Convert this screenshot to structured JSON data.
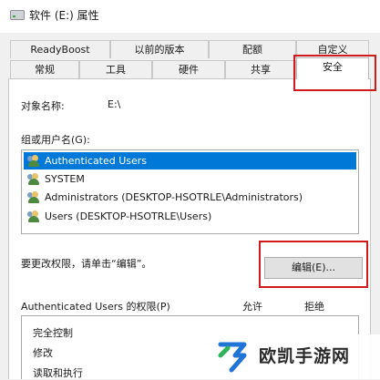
{
  "window": {
    "title": "软件 (E:) 属性"
  },
  "tabs_top": [
    "ReadyBoost",
    "以前的版本",
    "配额",
    "自定义"
  ],
  "tabs_bottom": [
    "常规",
    "工具",
    "硬件",
    "共享",
    "安全"
  ],
  "active_tab": "安全",
  "object": {
    "label": "对象名称:",
    "value": "E:\\"
  },
  "group_label": "组或用户名(G):",
  "users": [
    "Authenticated Users",
    "SYSTEM",
    "Administrators (DESKTOP-HSOTRLE\\Administrators)",
    "Users (DESKTOP-HSOTRLE\\Users)"
  ],
  "selected_user_index": 0,
  "change_hint": "要更改权限，请单击“编辑”。",
  "edit_button": "编辑(E)...",
  "permissions": {
    "header": "Authenticated Users 的权限(P)",
    "allow": "允许",
    "deny": "拒绝",
    "rows": [
      "完全控制",
      "修改",
      "读取和执行"
    ]
  },
  "watermark": {
    "text": "欧凯手游网"
  },
  "colors": {
    "selection": "#0078d7",
    "highlight_box": "#d11a1a",
    "watermark_blue": "#1f74d6"
  }
}
